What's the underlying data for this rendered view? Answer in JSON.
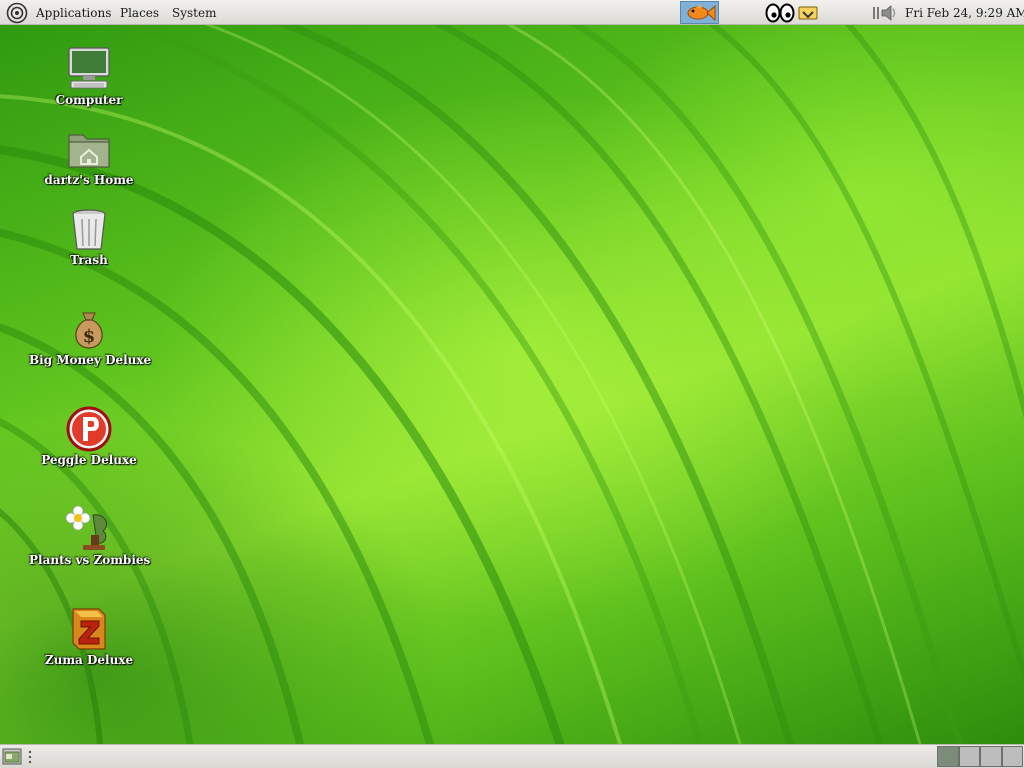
{
  "top_panel": {
    "menus": [
      "Applications",
      "Places",
      "System"
    ],
    "clock": "Fri Feb 24,  9:29 AM",
    "icons": [
      "gnome-foot-icon",
      "fish-icon",
      "eyes-icon",
      "notification-icon",
      "volume-icon"
    ]
  },
  "desktop": {
    "icons": [
      {
        "label": "Computer",
        "icon": "computer-icon"
      },
      {
        "label": "dartz's Home",
        "icon": "home-folder-icon"
      },
      {
        "label": "Trash",
        "icon": "trash-icon"
      },
      {
        "label": "Big Money Deluxe",
        "icon": "money-bag-icon"
      },
      {
        "label": "Peggle Deluxe",
        "icon": "peggle-icon"
      },
      {
        "label": "Plants vs Zombies",
        "icon": "plants-vs-zombies-icon"
      },
      {
        "label": "Zuma Deluxe",
        "icon": "zuma-icon"
      }
    ]
  },
  "bottom_panel": {
    "workspace_count": 4,
    "active_workspace": 1
  },
  "colors": {
    "wallpaper_green": "#5fc41e",
    "panel_bg": "#e6e4e0",
    "label_text": "#ffffff"
  }
}
